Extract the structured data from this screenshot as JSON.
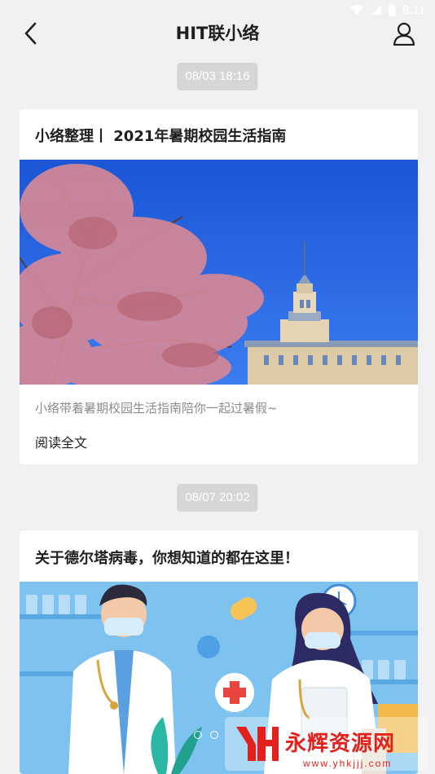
{
  "status_bar": {
    "time": "8:11",
    "icons": [
      "wifi-icon",
      "signal-icon",
      "battery-icon"
    ]
  },
  "nav": {
    "title": "HIT联小络",
    "back_icon": "chevron-left-icon",
    "profile_icon": "user-icon"
  },
  "feed": [
    {
      "timestamp": "08/03 18:16",
      "title": "小络整理丨 2021年暑期校园生活指南",
      "image": "campus-building-with-blossoms",
      "summary": "小络带着暑期校园生活指南陪你一起过暑假~",
      "read_more": "阅读全文"
    },
    {
      "timestamp": "08/07 20:02",
      "title": "关于德尔塔病毒，你想知道的都在这里！",
      "image": "medical-staff-illustration"
    }
  ],
  "watermark": {
    "text": "永辉资源网",
    "url": "www.yhkjjj.com"
  },
  "colors": {
    "page_background": "#f1f1f3",
    "card_background": "#ffffff",
    "timestamp_badge": "#d6d6d8",
    "summary_text": "#8c8c8c",
    "watermark_red": "#e2211c"
  }
}
